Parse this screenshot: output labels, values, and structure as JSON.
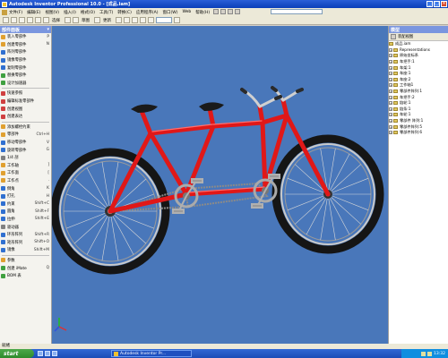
{
  "window": {
    "title": "Autodesk Inventor Professional 10.0 - [成品.iam]"
  },
  "menubar": {
    "items": [
      "文件(F)",
      "编辑(E)",
      "视图(V)",
      "插入(I)",
      "格式(O)",
      "工具(T)",
      "转换(C)",
      "应用程序(A)",
      "窗口(W)",
      "Web",
      "帮助(H)"
    ]
  },
  "toolbar": {
    "select_label": "选择",
    "sketch_label": "草图",
    "update_label": "更新"
  },
  "left_panel": {
    "title": "部件面板",
    "commands": [
      {
        "label": "装入零部件",
        "shortcut": "P",
        "color": "#e0a030"
      },
      {
        "label": "创建零部件",
        "shortcut": "N",
        "color": "#e0a030"
      },
      {
        "label": "阵列零部件",
        "shortcut": "",
        "color": "#3070d0"
      },
      {
        "label": "镜像零部件",
        "shortcut": "",
        "color": "#3070d0"
      },
      {
        "label": "复制零部件",
        "shortcut": "",
        "color": "#3070d0"
      },
      {
        "label": "替换零部件",
        "shortcut": "",
        "color": "#40a040"
      },
      {
        "label": "设计加速器",
        "shortcut": "",
        "color": "#40a040"
      },
      {
        "label": "",
        "shortcut": "",
        "sep": true
      },
      {
        "label": "快速参照",
        "shortcut": "",
        "color": "#d04040"
      },
      {
        "label": "编辑标准零部件",
        "shortcut": "",
        "color": "#d04040"
      },
      {
        "label": "创建视图",
        "shortcut": "",
        "color": "#d04040"
      },
      {
        "label": "创建表达",
        "shortcut": "",
        "color": "#d04040"
      },
      {
        "label": "",
        "shortcut": "",
        "sep": true
      },
      {
        "label": "添加螺栓约束",
        "shortcut": "",
        "color": "#e0a030"
      },
      {
        "label": "零部件",
        "shortcut": "Ctrl+H",
        "color": "#e0a030"
      },
      {
        "label": "移动零部件",
        "shortcut": "V",
        "color": "#3070d0"
      },
      {
        "label": "旋转零部件",
        "shortcut": "G",
        "color": "#3070d0"
      },
      {
        "label": "1/4 剖",
        "shortcut": "",
        "color": "#808080"
      },
      {
        "label": "工作轴",
        "shortcut": "]",
        "color": "#e0a030"
      },
      {
        "label": "工作面",
        "shortcut": "[",
        "color": "#e0a030"
      },
      {
        "label": "工作点",
        "shortcut": ".",
        "color": "#e0a030"
      },
      {
        "label": "倒角",
        "shortcut": "K",
        "color": "#3070d0"
      },
      {
        "label": "打孔",
        "shortcut": "H",
        "color": "#3070d0"
      },
      {
        "label": "约束",
        "shortcut": "Shift+C",
        "color": "#3070d0"
      },
      {
        "label": "圆角",
        "shortcut": "Shift+F",
        "color": "#3070d0"
      },
      {
        "label": "拉伸",
        "shortcut": "Shift+E",
        "color": "#3070d0"
      },
      {
        "label": "驱动器",
        "shortcut": "",
        "color": "#808080"
      },
      {
        "label": "环形阵列",
        "shortcut": "Shift+R",
        "color": "#3070d0"
      },
      {
        "label": "矩形阵列",
        "shortcut": "Shift+O",
        "color": "#3070d0"
      },
      {
        "label": "镜像",
        "shortcut": "Shift+M",
        "color": "#3070d0"
      },
      {
        "label": "",
        "shortcut": "",
        "sep": true
      },
      {
        "label": "参数",
        "shortcut": "",
        "color": "#e0a030"
      },
      {
        "label": "创建 iMate",
        "shortcut": "Q",
        "color": "#40a040"
      },
      {
        "label": "BOM 表",
        "shortcut": "",
        "color": "#40a040"
      }
    ]
  },
  "right_panel": {
    "title": "模型",
    "subheader": "装配视图",
    "root": "成品.iam",
    "items": [
      "Representations",
      "原始坐标系",
      "车把手:1",
      "车架:1",
      "车座:1",
      "车座:2",
      "工作轴1",
      "零部件阵列:1",
      "车把手:2",
      "链轮:1",
      "链条:1",
      "车轮:1",
      "零部件 阵列:1",
      "零部件阵列:5",
      "零部件阵列:6"
    ]
  },
  "statusbar": {
    "text": "就绪"
  },
  "taskbar": {
    "start_label": "start",
    "task_label": "Autodesk Inventor Pr...",
    "clock": "13:32"
  },
  "colors": {
    "viewport_bg": "#4977ba",
    "frame": "#e01818",
    "title_bar": "#1a50c8"
  },
  "icons": [
    "app-icon",
    "minimize-icon",
    "maximize-icon",
    "close-icon",
    "start-icon",
    "view-cube-axes-icon"
  ]
}
